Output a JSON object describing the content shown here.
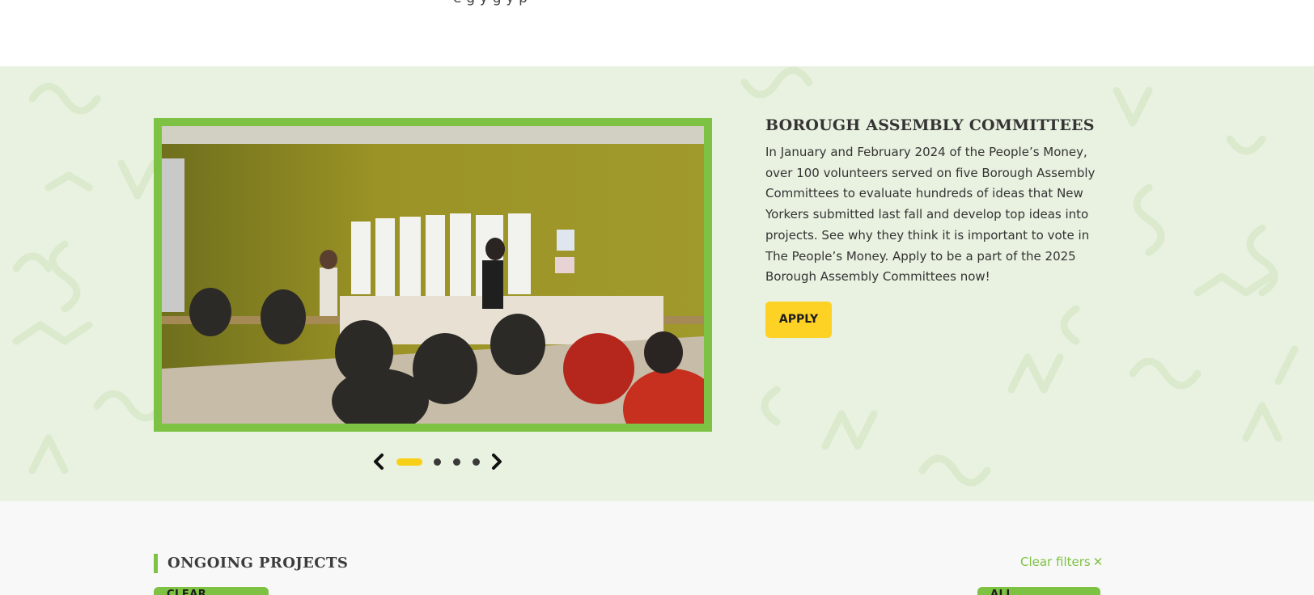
{
  "top_strip": {
    "cut_text": "e     g                                     y          g                    y     p"
  },
  "carousel": {
    "slides_count": 4,
    "active_slide": 1
  },
  "feature": {
    "title": "BOROUGH ASSEMBLY COMMITTEES",
    "body": "In January and February 2024 of the People’s Money, over 100 volunteers served on five Borough Assembly Committees to evaluate hundreds of ideas that New Yorkers submitted last fall and develop top ideas into projects. See why they think it is important to vote in The People’s Money. Apply to be a part of the 2025 Borough Assembly Committees now!",
    "apply_label": "APPLY"
  },
  "projects": {
    "title": "ONGOING PROJECTS",
    "clear_filters_link": "Clear filters",
    "clear_filters_icon": "close-icon",
    "left_button": "CLEAR FILTERS",
    "right_button": "ALL PROGRAMS"
  },
  "colors": {
    "accent_green": "#7dc242",
    "button_yellow": "#fed225",
    "hero_bg": "#e9f2e1"
  }
}
